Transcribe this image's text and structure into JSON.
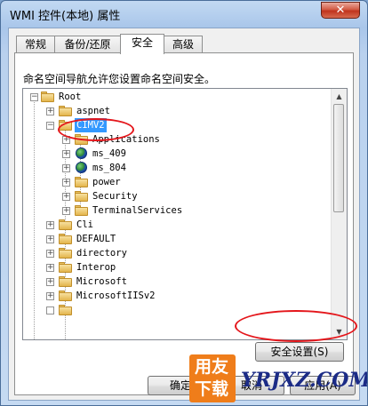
{
  "window": {
    "title": "WMI 控件(本地) 属性",
    "close_symbol": "✕"
  },
  "tabs": [
    {
      "label": "常规",
      "active": false
    },
    {
      "label": "备份/还原",
      "active": false
    },
    {
      "label": "安全",
      "active": true
    },
    {
      "label": "高级",
      "active": false
    }
  ],
  "security": {
    "description": "命名空间导航允许您设置命名空间安全。",
    "tree": [
      {
        "label": "Root",
        "expander": "−",
        "icon": "folder-icon"
      },
      {
        "label": "aspnet",
        "expander": "+",
        "icon": "folder-icon"
      },
      {
        "label": "CIMV2",
        "expander": "−",
        "icon": "folder-icon",
        "selected": true
      },
      {
        "label": "Applications",
        "expander": "+",
        "icon": "folder-icon"
      },
      {
        "label": "ms_409",
        "expander": "+",
        "icon": "globe-icon"
      },
      {
        "label": "ms_804",
        "expander": "+",
        "icon": "globe-icon"
      },
      {
        "label": "power",
        "expander": "+",
        "icon": "folder-icon"
      },
      {
        "label": "Security",
        "expander": "+",
        "icon": "folder-icon"
      },
      {
        "label": "TerminalServices",
        "expander": "+",
        "icon": "folder-icon"
      },
      {
        "label": "Cli",
        "expander": "+",
        "icon": "folder-icon"
      },
      {
        "label": "DEFAULT",
        "expander": "+",
        "icon": "folder-icon"
      },
      {
        "label": "directory",
        "expander": "+",
        "icon": "folder-icon"
      },
      {
        "label": "Interop",
        "expander": "+",
        "icon": "folder-icon"
      },
      {
        "label": "Microsoft",
        "expander": "+",
        "icon": "folder-icon"
      },
      {
        "label": "MicrosoftIISv2",
        "expander": "+",
        "icon": "folder-icon"
      }
    ],
    "security_settings_button": "安全设置(S)"
  },
  "footer": {
    "ok": "确定",
    "cancel": "取消",
    "apply": "应用(A)"
  },
  "watermark": {
    "logo_top": "用友",
    "logo_bottom": "下载",
    "site": "YRJXZ.COM"
  },
  "colors": {
    "selection": "#3399ff",
    "annotation": "#e4161b",
    "watermark_orange": "#ef7d1a"
  }
}
